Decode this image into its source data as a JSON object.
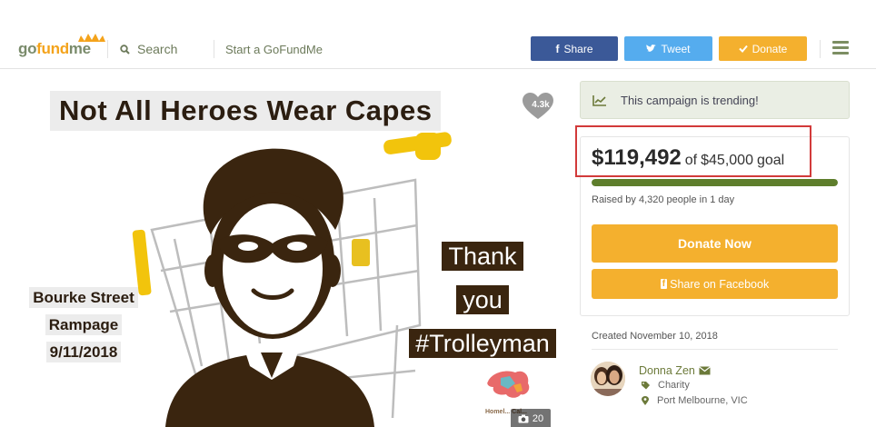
{
  "header": {
    "logo_go": "go",
    "logo_fund": "fund",
    "logo_me": "me",
    "search_label": "Search",
    "start_label": "Start a GoFundMe",
    "share_label": "Share",
    "tweet_label": "Tweet",
    "donate_label": "Donate"
  },
  "hero": {
    "title": "Not All Heroes Wear Capes",
    "likes": "4.3k",
    "caption_lines": [
      "Bourke Street",
      "Rampage",
      "9/11/2018"
    ],
    "thank_lines": [
      "Thank",
      "you",
      "#Trolleyman"
    ],
    "photo_count": "20",
    "charity_logo_text": "Homel... Cal..."
  },
  "sidebar": {
    "trending_text": "This campaign is trending!",
    "raised_amount": "$119,492",
    "raised_of": "of",
    "goal_amount": "$45,000",
    "goal_word": "goal",
    "progress_fraction": 1.0,
    "raised_by": "Raised by 4,320 people in 1 day",
    "donate_now_label": "Donate Now",
    "share_facebook_label": "Share on Facebook",
    "created": "Created November 10, 2018",
    "organizer_name": "Donna Zen",
    "category": "Charity",
    "location": "Port Melbourne, VIC"
  },
  "colors": {
    "brand_green": "#7a8b6b",
    "brand_orange": "#f4a31b",
    "facebook": "#3b5998",
    "twitter": "#55acee",
    "donate": "#f4b02e",
    "progress": "#5e7e2c",
    "highlight_box": "#d23a3a"
  },
  "icons": [
    "search-icon",
    "facebook-icon",
    "twitter-icon",
    "check-icon",
    "hamburger-menu-icon",
    "heart-icon",
    "camera-icon",
    "trending-chart-icon",
    "email-icon",
    "tag-icon",
    "location-pin-icon"
  ]
}
